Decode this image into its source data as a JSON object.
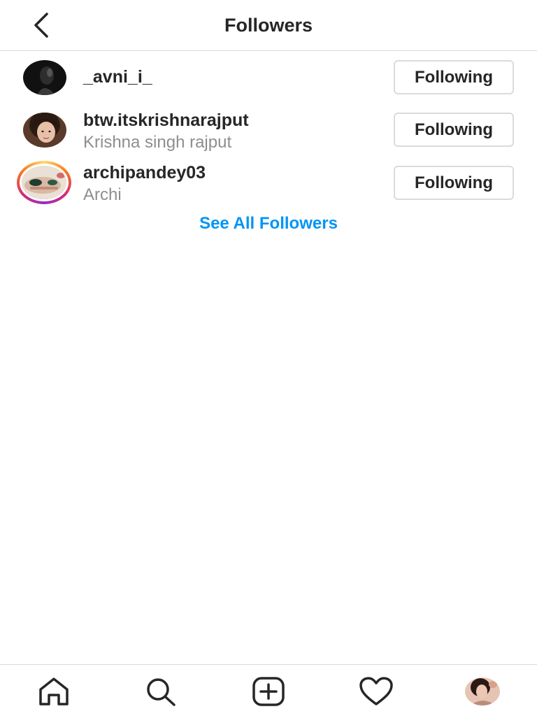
{
  "header": {
    "title": "Followers",
    "back_icon": "chevron-left-icon"
  },
  "followers": [
    {
      "username": "_avni_i_",
      "full_name": "",
      "button_label": "Following",
      "has_story": false
    },
    {
      "username": "btw.itskrishnarajput",
      "full_name": "Krishna singh rajput",
      "button_label": "Following",
      "has_story": false
    },
    {
      "username": "archipandey03",
      "full_name": "Archi",
      "button_label": "Following",
      "has_story": true
    }
  ],
  "see_all_label": "See All Followers",
  "bottom_nav": {
    "items": [
      "home-icon",
      "search-icon",
      "new-post-icon",
      "heart-icon",
      "profile-avatar"
    ]
  },
  "colors": {
    "link": "#0095f6",
    "text": "#262626",
    "secondary_text": "#8e8e8e",
    "border": "#dbdbdb"
  }
}
